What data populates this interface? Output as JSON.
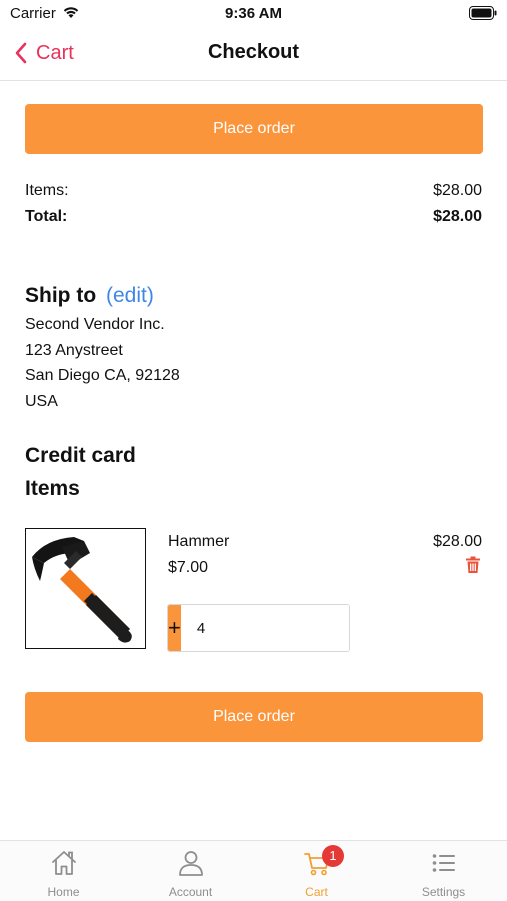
{
  "status_bar": {
    "carrier": "Carrier",
    "time": "9:36 AM"
  },
  "nav": {
    "back_label": "Cart",
    "title": "Checkout"
  },
  "actions": {
    "place_order_label": "Place order"
  },
  "summary": {
    "items_label": "Items:",
    "items_value": "$28.00",
    "total_label": "Total:",
    "total_value": "$28.00"
  },
  "ship_to": {
    "heading": "Ship to",
    "edit_label": "(edit)",
    "lines": [
      "Second Vendor Inc.",
      "123 Anystreet",
      "San Diego CA, 92128",
      "USA"
    ]
  },
  "credit_card": {
    "heading": "Credit card"
  },
  "items_section": {
    "heading": "Items",
    "items": [
      {
        "name": "Hammer",
        "unit_price": "$7.00",
        "line_total": "$28.00",
        "quantity": "4",
        "increment_label": "+",
        "decrement_label": "−"
      }
    ]
  },
  "tab_bar": {
    "tabs": [
      {
        "label": "Home",
        "icon": "home-icon",
        "active": false
      },
      {
        "label": "Account",
        "icon": "account-icon",
        "active": false
      },
      {
        "label": "Cart",
        "icon": "cart-icon",
        "active": true,
        "badge": "1"
      },
      {
        "label": "Settings",
        "icon": "settings-list-icon",
        "active": false
      }
    ]
  },
  "colors": {
    "accent_orange": "#fb953c",
    "back_red": "#e8325a",
    "link_blue": "#3f87e6",
    "active_tab": "#f0a033",
    "badge_red": "#e53935",
    "trash_red": "#e8533a"
  }
}
